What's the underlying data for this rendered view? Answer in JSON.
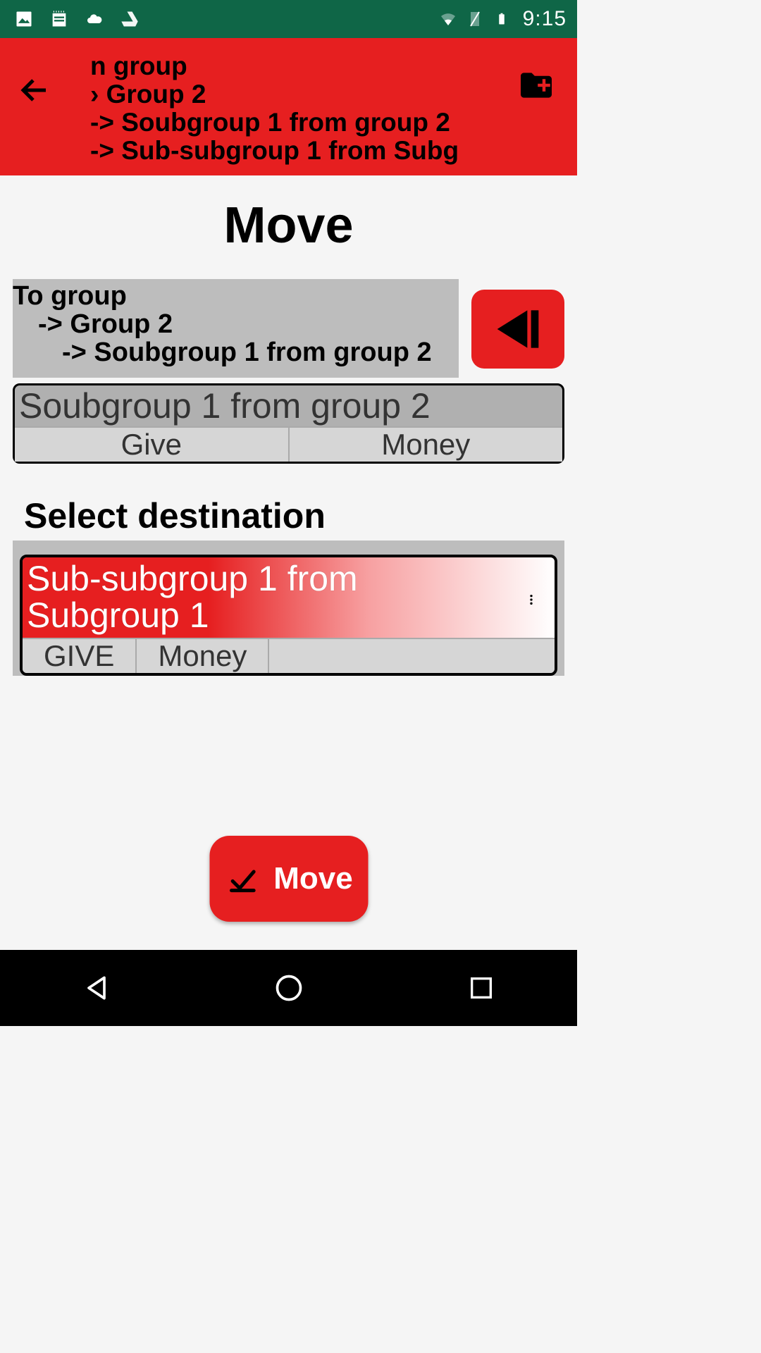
{
  "statusbar": {
    "time": "9:15"
  },
  "appbar": {
    "breadcrumb": {
      "l1": "n group",
      "l2": "› Group 2",
      "l3": " -> Soubgroup 1 from group 2",
      "l4": "   -> Sub-subgroup 1 from Subg"
    }
  },
  "page": {
    "title": "Move"
  },
  "source": {
    "path": {
      "l1": "To group",
      "l2": "  -> Group 2",
      "l3": "    -> Soubgroup 1 from group 2"
    },
    "card": {
      "title": "Soubgroup 1 from group 2",
      "tag1": "Give",
      "tag2": "Money"
    }
  },
  "destination": {
    "heading": "Select destination",
    "card": {
      "title": "Sub-subgroup 1 from Subgroup 1",
      "tag1": "GIVE",
      "tag2": "Money"
    }
  },
  "move_button": {
    "label": "Move"
  }
}
